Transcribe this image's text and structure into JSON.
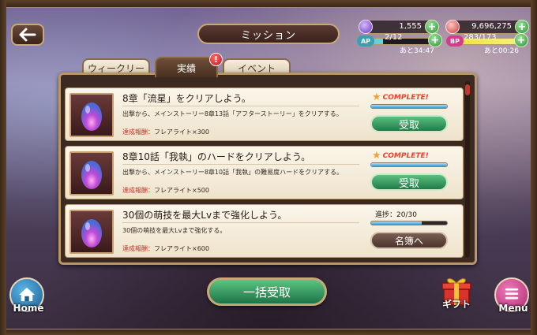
{
  "header": {
    "back_icon": "back-arrow-icon",
    "title": "ミッション"
  },
  "resources": {
    "crystal": {
      "value": "1,555",
      "icon": "crystal-icon",
      "color": "#8a6ad8"
    },
    "money": {
      "value": "9,696,275",
      "icon": "coin-icon",
      "color": "#e86a6a"
    }
  },
  "stamina": {
    "ap": {
      "label": "AP",
      "value": "2/12",
      "timer": "あと34:47",
      "fill_fraction": 0.17,
      "color": "#6ad0d8"
    },
    "bp": {
      "label": "BP",
      "value": "283/173",
      "timer": "あと00:26",
      "fill_fraction": 1.0,
      "color": "#f0e63a"
    }
  },
  "tabs": [
    {
      "label": "ウィークリー",
      "active": false
    },
    {
      "label": "実績",
      "active": true
    },
    {
      "label": "イベント",
      "active": false
    }
  ],
  "tab_badge": "!",
  "missions": [
    {
      "title": "8章「流星」をクリアしよう。",
      "description": "出撃から、メインストーリー8章13話「アフターストーリー」をクリアする。",
      "reward_label": "達成報酬：",
      "reward_value": "フレアライト×300",
      "status": "COMPLETE!",
      "progress_fraction": 1.0,
      "button": "受取"
    },
    {
      "title": "8章10話「我執」のハードをクリアしよう。",
      "description": "出撃から、メインストーリー8章10話「我執」の難易度ハードをクリアする。",
      "reward_label": "達成報酬：",
      "reward_value": "フレアライト×500",
      "status": "COMPLETE!",
      "progress_fraction": 1.0,
      "button": "受取"
    },
    {
      "title": "30個の萌技を最大Lvまで強化しよう。",
      "description": "30個の萌技を最大Lvまで強化する。",
      "reward_label": "達成報酬：",
      "reward_value": "フレアライト×600",
      "progress_text": "進捗：20/30",
      "progress_fraction": 0.667,
      "button": "名簿へ"
    }
  ],
  "bottom": {
    "bulk_receive": "一括受取",
    "home": "Home",
    "gift": "ギフト",
    "menu": "Menu"
  }
}
